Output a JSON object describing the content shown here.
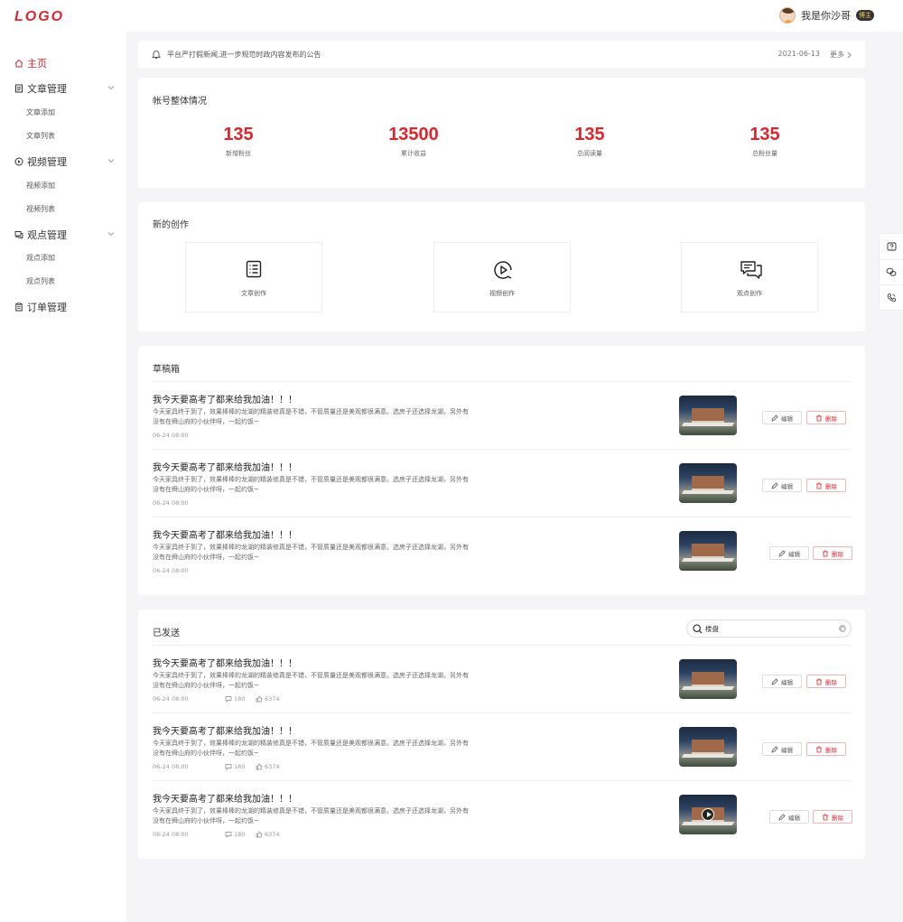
{
  "header": {
    "logo": "LOGO",
    "user_name": "我是你沙哥",
    "user_badge": "博主"
  },
  "sidebar": {
    "items": [
      {
        "label": "主页",
        "icon": "home-icon",
        "active": true
      },
      {
        "label": "文章管理",
        "icon": "article-icon",
        "sub": [
          "文章添加",
          "文章列表"
        ]
      },
      {
        "label": "视频管理",
        "icon": "video-icon",
        "sub": [
          "视频添加",
          "视频列表"
        ]
      },
      {
        "label": "观点管理",
        "icon": "comment-icon",
        "sub": [
          "观点添加",
          "观点列表"
        ]
      },
      {
        "label": "订单管理",
        "icon": "order-icon"
      }
    ]
  },
  "notice": {
    "text": "平台严打假新闻,进一步规范时政内容发布的公告",
    "date": "2021-06-13",
    "more": "更多"
  },
  "account": {
    "title": "帐号整体情况",
    "stats": [
      {
        "value": "135",
        "label": "新增粉丝"
      },
      {
        "value": "13500",
        "label": "累计收益"
      },
      {
        "value": "135",
        "label": "总阅读量"
      },
      {
        "value": "135",
        "label": "总粉丝量"
      }
    ]
  },
  "create": {
    "title": "新的创作",
    "items": [
      {
        "label": "文章创作",
        "icon": "article-create-icon"
      },
      {
        "label": "视频创作",
        "icon": "video-create-icon"
      },
      {
        "label": "观点创作",
        "icon": "opinion-create-icon"
      }
    ]
  },
  "drafts": {
    "title": "草稿箱",
    "rows": [
      {
        "title": "我今天要高考了都来给我加油！！！",
        "desc": "今天家具终于到了，效果棒棒的龙湖的精装修真是不错，不管质量还是美观都很满意。选房子还选择龙湖，另外有没有在舜山府的小伙伴呀，一起约饭~",
        "date": "06-24  08:00",
        "edit": "编辑",
        "delete": "删除"
      },
      {
        "title": "我今天要高考了都来给我加油！！！",
        "desc": "今天家具终于到了，效果棒棒的龙湖的精装修真是不错，不管质量还是美观都很满意。选房子还选择龙湖，另外有没有在舜山府的小伙伴呀，一起约饭~",
        "date": "06-24  08:00",
        "edit": "编辑",
        "delete": "删除"
      },
      {
        "title": "我今天要高考了都来给我加油！！！",
        "desc": "今天家具终于到了，效果棒棒的龙湖的精装修真是不错，不管质量还是美观都很满意。选房子还选择龙湖，另外有没有在舜山府的小伙伴呀，一起约饭~",
        "date": "06-24  08:00",
        "edit": "编辑",
        "delete": "删除"
      }
    ]
  },
  "sent": {
    "title": "已发送",
    "search_value": "楼盘",
    "rows": [
      {
        "title": "我今天要高考了都来给我加油！！！",
        "desc": "今天家具终于到了，效果棒棒的龙湖的精装修真是不错，不管质量还是美观都很满意。选房子还选择龙湖，另外有没有在舜山府的小伙伴呀，一起约饭~",
        "date": "06-24  08:00",
        "comments": "180",
        "likes": "6374",
        "edit": "编辑",
        "delete": "删除"
      },
      {
        "title": "我今天要高考了都来给我加油！！！",
        "desc": "今天家具终于到了，效果棒棒的龙湖的精装修真是不错，不管质量还是美观都很满意。选房子还选择龙湖，另外有没有在舜山府的小伙伴呀，一起约饭~",
        "date": "06-24  08:00",
        "comments": "180",
        "likes": "6374",
        "edit": "编辑",
        "delete": "删除"
      },
      {
        "title": "我今天要高考了都来给我加油！！！",
        "desc": "今天家具终于到了，效果棒棒的龙湖的精装修真是不错，不管质量还是美观都很满意。选房子还选择龙湖，另外有没有在舜山府的小伙伴呀，一起约饭~",
        "date": "06-24  08:00",
        "comments": "180",
        "likes": "6374",
        "edit": "编辑",
        "delete": "删除",
        "is_video": true
      }
    ]
  },
  "float_bar": [
    "help-icon",
    "chat-icon",
    "phone-icon"
  ],
  "colors": {
    "accent": "#e0242c",
    "background": "#f5f5f7"
  }
}
